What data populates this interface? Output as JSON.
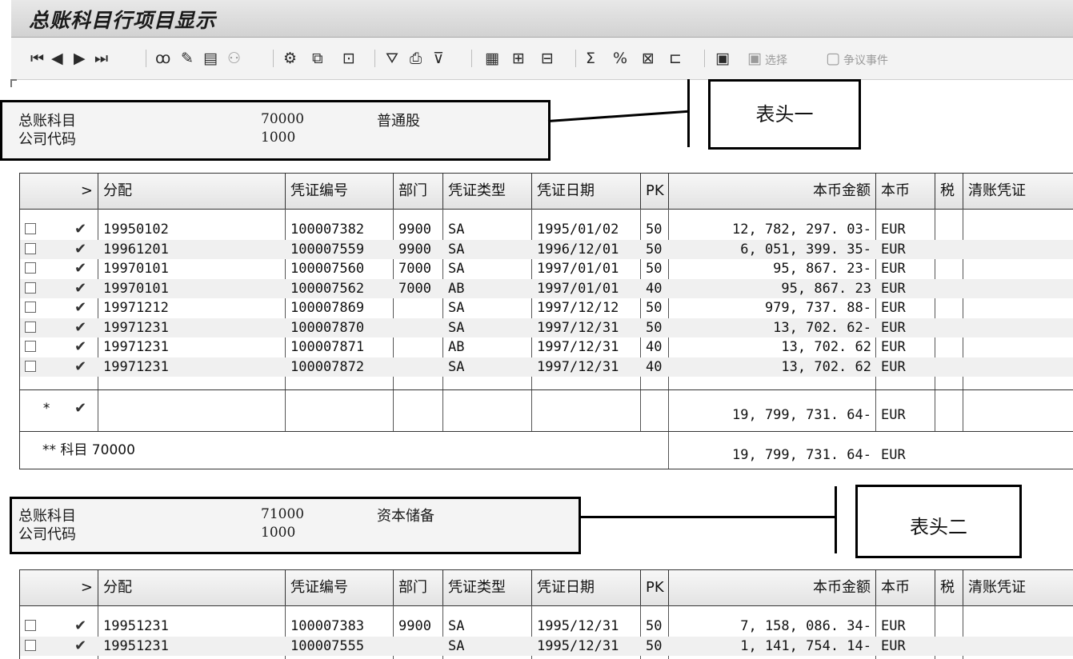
{
  "title": "总账科目行项目显示",
  "toolbar": {
    "select_label": "选择",
    "dispute_label": "争议事件"
  },
  "columns": [
    "分配",
    "凭证编号",
    "部门",
    "凭证类型",
    "凭证日期",
    "PK",
    "本币金额",
    "本币",
    "税",
    "清账凭证"
  ],
  "header1": {
    "gl_label": "总账科目",
    "gl_value": "70000",
    "gl_name": "普通股",
    "cc_label": "公司代码",
    "cc_value": "1000",
    "callout": "表头一"
  },
  "header2": {
    "gl_label": "总账科目",
    "gl_value": "71000",
    "gl_name": "资本储备",
    "cc_label": "公司代码",
    "cc_value": "1000",
    "callout": "表头二"
  },
  "table1": {
    "rows": [
      {
        "assign": "19950102",
        "doc": "100007382",
        "dept": "9900",
        "type": "SA",
        "date": "1995/01/02",
        "pk": "50",
        "amount": "12, 782, 297. 03-",
        "cur": "EUR"
      },
      {
        "assign": "19961201",
        "doc": "100007559",
        "dept": "9900",
        "type": "SA",
        "date": "1996/12/01",
        "pk": "50",
        "amount": "6, 051, 399. 35-",
        "cur": "EUR"
      },
      {
        "assign": "19970101",
        "doc": "100007560",
        "dept": "7000",
        "type": "SA",
        "date": "1997/01/01",
        "pk": "50",
        "amount": "95, 867. 23-",
        "cur": "EUR"
      },
      {
        "assign": "19970101",
        "doc": "100007562",
        "dept": "7000",
        "type": "AB",
        "date": "1997/01/01",
        "pk": "40",
        "amount": "95, 867. 23",
        "cur": "EUR"
      },
      {
        "assign": "19971212",
        "doc": "100007869",
        "dept": "",
        "type": "SA",
        "date": "1997/12/12",
        "pk": "50",
        "amount": "979, 737. 88-",
        "cur": "EUR"
      },
      {
        "assign": "19971231",
        "doc": "100007870",
        "dept": "",
        "type": "SA",
        "date": "1997/12/31",
        "pk": "50",
        "amount": "13, 702. 62-",
        "cur": "EUR"
      },
      {
        "assign": "19971231",
        "doc": "100007871",
        "dept": "",
        "type": "AB",
        "date": "1997/12/31",
        "pk": "40",
        "amount": "13, 702. 62",
        "cur": "EUR"
      },
      {
        "assign": "19971231",
        "doc": "100007872",
        "dept": "",
        "type": "SA",
        "date": "1997/12/31",
        "pk": "40",
        "amount": "13, 702. 62",
        "cur": "EUR"
      }
    ],
    "subtotal": {
      "marker": "*",
      "amount": "19, 799, 731. 64-",
      "cur": "EUR"
    },
    "total": {
      "label": "** 科目 70000",
      "amount": "19, 799, 731. 64-",
      "cur": "EUR"
    }
  },
  "table2": {
    "rows": [
      {
        "assign": "19951231",
        "doc": "100007383",
        "dept": "9900",
        "type": "SA",
        "date": "1995/12/31",
        "pk": "50",
        "amount": "7, 158, 086. 34-",
        "cur": "EUR"
      },
      {
        "assign": "19951231",
        "doc": "100007555",
        "dept": "",
        "type": "SA",
        "date": "1995/12/31",
        "pk": "50",
        "amount": "1, 141, 754. 14-",
        "cur": "EUR"
      }
    ]
  }
}
